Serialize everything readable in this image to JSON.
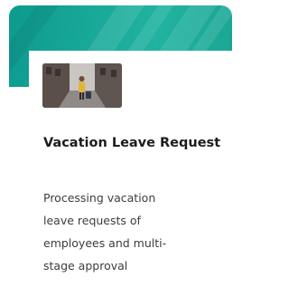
{
  "card": {
    "title": "Vacation Leave Request",
    "description": "Processing vacation leave requests of employees and multi-stage approval",
    "accent_color": "#1aa593"
  }
}
